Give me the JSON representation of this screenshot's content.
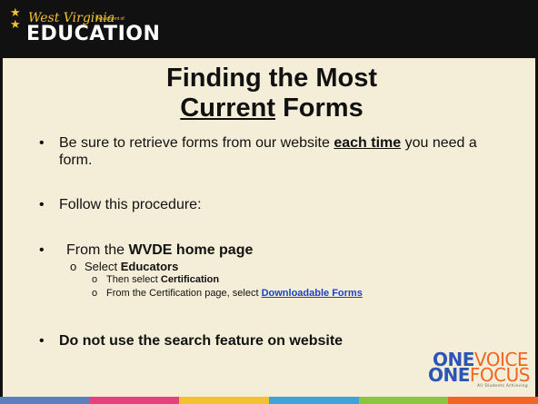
{
  "logo": {
    "state_name": "West Virginia",
    "dept_text": "Department of",
    "agency": "EDUCATION"
  },
  "title": {
    "line1": "Finding the Most",
    "current_word": "Current",
    "line2_rest": " Forms"
  },
  "bullets": {
    "b1_pre": "Be sure to retrieve forms from our website ",
    "b1_emph": "each time",
    "b1_post": " you need a form.",
    "b2": "Follow this procedure:",
    "b3_pre": "From the ",
    "b3_emph": "WVDE home page",
    "b3_sub1_pre": "Select ",
    "b3_sub1_emph": "Educators",
    "b3_sub2_pre": "Then select ",
    "b3_sub2_emph": "Certification",
    "b3_sub3_pre": "From the Certification page, select ",
    "b3_sub3_link": "Downloadable Forms",
    "b4": "Do not use the search feature on website"
  },
  "onevoice": {
    "one1": "ONE",
    "voice": "VOICE",
    "one2": "ONE",
    "focus": "FOCUS",
    "tag": "All Students Achieving"
  },
  "colors": {
    "background": "#f4eed8",
    "header": "#111111",
    "gold": "#f2c230",
    "link": "#1d3fc8",
    "onevoice_blue": "#2b55b6",
    "onevoice_orange": "#f26522",
    "footer": [
      "#5b7fbf",
      "#e5427d",
      "#f2c230",
      "#3ca4d8",
      "#8cc63f",
      "#f26522"
    ]
  }
}
